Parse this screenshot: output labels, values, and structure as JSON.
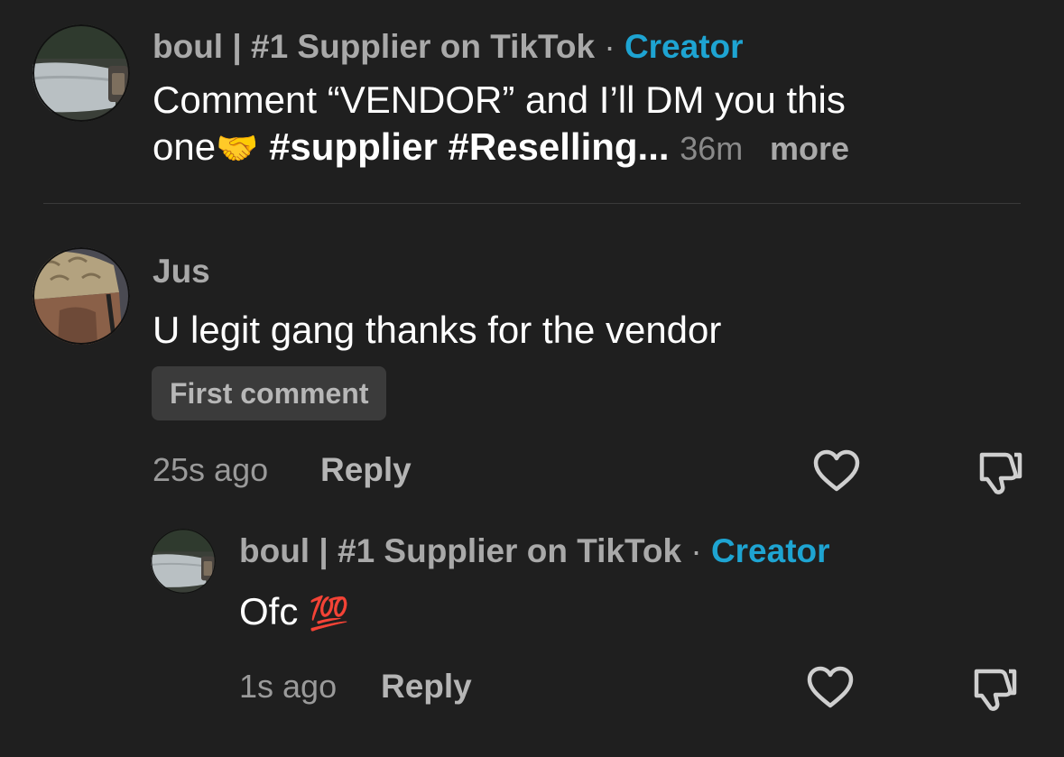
{
  "caption": {
    "username": "boul | #1 Supplier on TikTok",
    "separator": "·",
    "badge": "Creator",
    "line1": "Comment “VENDOR” and I’ll DM you this",
    "line2_start": "one",
    "handshake_emoji": "🤝",
    "hashtags": "#supplier #Reselling...",
    "time": "36m",
    "more_label": "more"
  },
  "comment": {
    "username": "Jus",
    "text": "U legit gang thanks for the vendor",
    "badge": "First comment",
    "time": "25s ago",
    "reply_label": "Reply"
  },
  "reply": {
    "username": "boul | #1 Supplier on TikTok",
    "separator": "·",
    "badge": "Creator",
    "text": "Ofc",
    "hundred_emoji": "💯",
    "time": "1s ago",
    "reply_label": "Reply"
  },
  "icons": {
    "like": "heart-icon",
    "dislike": "thumbs-down-icon"
  },
  "colors": {
    "background": "#1f1f1f",
    "creator_accent": "#1ea4d2",
    "username": "#a9a9a9"
  }
}
